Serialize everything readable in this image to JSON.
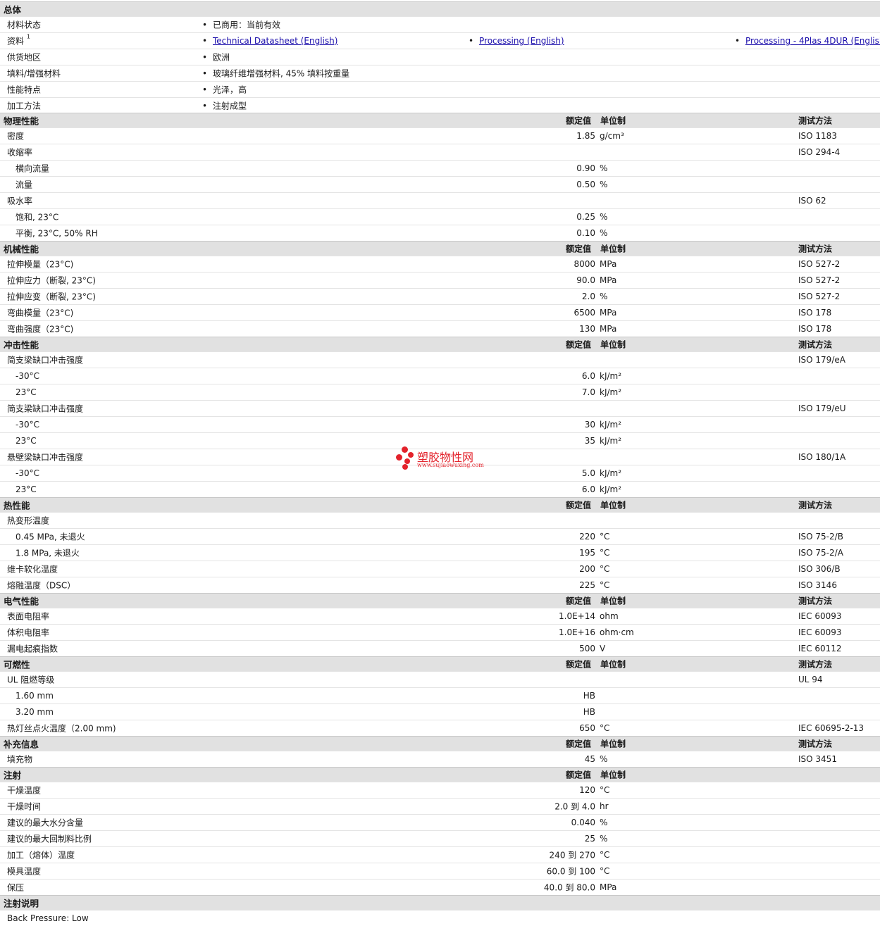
{
  "general": {
    "title": "总体",
    "status_label": "材料状态",
    "status_value": "已商用：当前有效",
    "docs_label": "资料",
    "docs_sup": "1",
    "docs": [
      "Technical Datasheet (English)",
      "Processing (English)",
      "Processing - 4Plas 4DUR (English"
    ],
    "region_label": "供货地区",
    "region_value": "欧洲",
    "filler_label": "填料/增强材料",
    "filler_value": "玻璃纤维增强材料, 45% 填料按重量",
    "feature_label": "性能特点",
    "feature_value": "光泽，高",
    "process_label": "加工方法",
    "process_value": "注射成型"
  },
  "headers": {
    "value": "额定值",
    "unit": "单位制",
    "test": "测试方法"
  },
  "physical": {
    "title": "物理性能",
    "rows": [
      {
        "label": "密度",
        "value": "1.85",
        "unit": "g/cm³",
        "test": "ISO 1183"
      },
      {
        "label": "收缩率",
        "value": "",
        "unit": "",
        "test": "ISO 294-4"
      },
      {
        "label": "横向流量",
        "value": "0.90",
        "unit": "%",
        "test": ""
      },
      {
        "label": "流量",
        "value": "0.50",
        "unit": "%",
        "test": ""
      },
      {
        "label": "吸水率",
        "value": "",
        "unit": "",
        "test": "ISO 62"
      },
      {
        "label": "饱和, 23°C",
        "value": "0.25",
        "unit": "%",
        "test": ""
      },
      {
        "label": "平衡, 23°C, 50% RH",
        "value": "0.10",
        "unit": "%",
        "test": ""
      }
    ]
  },
  "mechanical": {
    "title": "机械性能",
    "rows": [
      {
        "label": "拉伸模量（23°C)",
        "value": "8000",
        "unit": "MPa",
        "test": "ISO 527-2"
      },
      {
        "label": "拉伸应力（断裂, 23°C)",
        "value": "90.0",
        "unit": "MPa",
        "test": "ISO 527-2"
      },
      {
        "label": "拉伸应变（断裂, 23°C)",
        "value": "2.0",
        "unit": "%",
        "test": "ISO 527-2"
      },
      {
        "label": "弯曲模量（23°C)",
        "value": "6500",
        "unit": "MPa",
        "test": "ISO 178"
      },
      {
        "label": "弯曲强度（23°C)",
        "value": "130",
        "unit": "MPa",
        "test": "ISO 178"
      }
    ]
  },
  "impact": {
    "title": "冲击性能",
    "rows": [
      {
        "label": "简支梁缺口冲击强度",
        "value": "",
        "unit": "",
        "test": "ISO 179/eA"
      },
      {
        "label": "-30°C",
        "value": "6.0",
        "unit": "kJ/m²",
        "test": ""
      },
      {
        "label": "23°C",
        "value": "7.0",
        "unit": "kJ/m²",
        "test": ""
      },
      {
        "label": "简支梁缺口冲击强度",
        "value": "",
        "unit": "",
        "test": "ISO 179/eU"
      },
      {
        "label": "-30°C",
        "value": "30",
        "unit": "kJ/m²",
        "test": ""
      },
      {
        "label": "23°C",
        "value": "35",
        "unit": "kJ/m²",
        "test": ""
      },
      {
        "label": "悬壁梁缺口冲击强度",
        "value": "",
        "unit": "",
        "test": "ISO 180/1A"
      },
      {
        "label": "-30°C",
        "value": "5.0",
        "unit": "kJ/m²",
        "test": ""
      },
      {
        "label": "23°C",
        "value": "6.0",
        "unit": "kJ/m²",
        "test": ""
      }
    ]
  },
  "thermal": {
    "title": "热性能",
    "rows": [
      {
        "label": "热变形温度",
        "value": "",
        "unit": "",
        "test": ""
      },
      {
        "label": "0.45 MPa, 未退火",
        "value": "220",
        "unit": "°C",
        "test": "ISO 75-2/B"
      },
      {
        "label": "1.8 MPa, 未退火",
        "value": "195",
        "unit": "°C",
        "test": "ISO 75-2/A"
      },
      {
        "label": "维卡软化温度",
        "value": "200",
        "unit": "°C",
        "test": "ISO 306/B"
      },
      {
        "label": "熔融温度（DSC）",
        "value": "225",
        "unit": "°C",
        "test": "ISO 3146"
      }
    ]
  },
  "electrical": {
    "title": "电气性能",
    "rows": [
      {
        "label": "表面电阻率",
        "value": "1.0E+14",
        "unit": "ohm",
        "test": "IEC 60093"
      },
      {
        "label": "体积电阻率",
        "value": "1.0E+16",
        "unit": "ohm·cm",
        "test": "IEC 60093"
      },
      {
        "label": "漏电起痕指数",
        "value": "500",
        "unit": "V",
        "test": "IEC 60112"
      }
    ]
  },
  "flammability": {
    "title": "可燃性",
    "rows": [
      {
        "label": "UL 阻燃等级",
        "value": "",
        "unit": "",
        "test": "UL 94"
      },
      {
        "label": "1.60 mm",
        "value": "HB",
        "unit": "",
        "test": ""
      },
      {
        "label": "3.20 mm",
        "value": "HB",
        "unit": "",
        "test": ""
      },
      {
        "label": "热灯丝点火温度（2.00 mm)",
        "value": "650",
        "unit": "°C",
        "test": "IEC 60695-2-13"
      }
    ]
  },
  "supplement": {
    "title": "补充信息",
    "rows": [
      {
        "label": "填充物",
        "value": "45",
        "unit": "%",
        "test": "ISO 3451"
      }
    ]
  },
  "injection": {
    "title": "注射",
    "rows": [
      {
        "label": "干燥温度",
        "value": "120",
        "unit": "°C",
        "test": ""
      },
      {
        "label": "干燥时间",
        "value": "2.0 到 4.0",
        "unit": "hr",
        "test": ""
      },
      {
        "label": "建议的最大水分含量",
        "value": "0.040",
        "unit": "%",
        "test": ""
      },
      {
        "label": "建议的最大回制料比例",
        "value": "25",
        "unit": "%",
        "test": ""
      },
      {
        "label": "加工（熔体）温度",
        "value": "240 到 270",
        "unit": "°C",
        "test": ""
      },
      {
        "label": "模具温度",
        "value": "60.0 到 100",
        "unit": "°C",
        "test": ""
      },
      {
        "label": "保压",
        "value": "40.0 到 80.0",
        "unit": "MPa",
        "test": ""
      }
    ]
  },
  "injection_notes": {
    "title": "注射说明",
    "text": "Back Pressure: Low"
  },
  "watermark": {
    "text": "塑胶物性网",
    "url": "www.sujiaowuxing.com"
  }
}
